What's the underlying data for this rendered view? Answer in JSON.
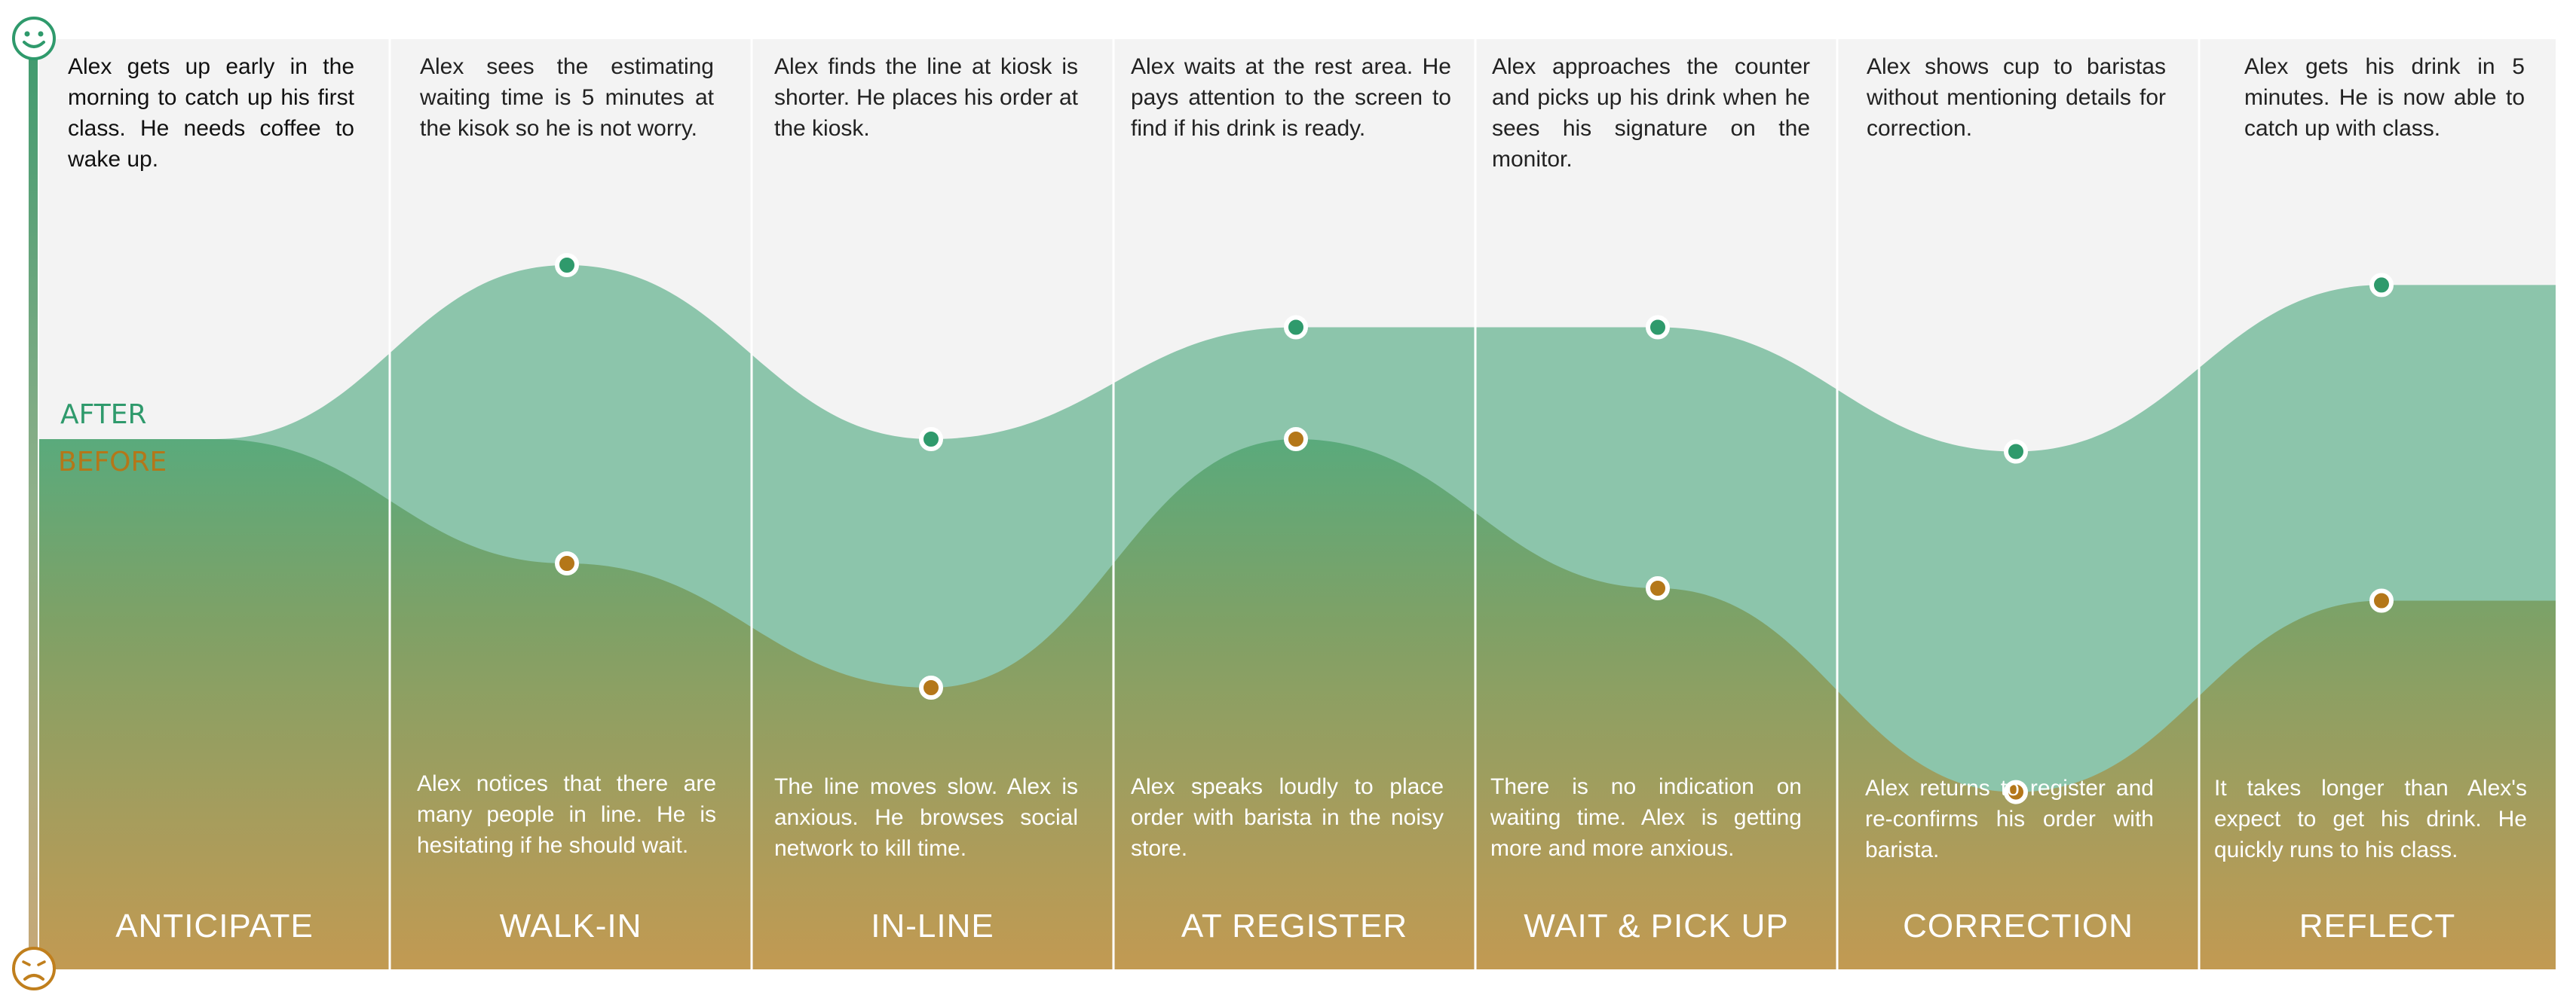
{
  "series": [
    {
      "name": "AFTER",
      "color": "#2f9a6c",
      "values": [
        0.0,
        0.7,
        0.0,
        0.45,
        0.45,
        -0.05,
        0.62
      ]
    },
    {
      "name": "BEFORE",
      "color": "#b47719",
      "values": [
        0.0,
        -0.5,
        -1.0,
        0.0,
        -0.6,
        -1.42,
        -0.65
      ]
    }
  ],
  "stages": [
    {
      "label": "ANTICIPATE",
      "top_text": "Alex gets up early in the morning to catch up his first class. He needs coffee to wake up.",
      "bottom_text": ""
    },
    {
      "label": "WALK-IN",
      "top_text": "Alex sees the estimating waiting time is 5 minutes at the kisok so he is not worry.",
      "bottom_text": "Alex notices that there are many people in line. He is hesitating if he should wait."
    },
    {
      "label": "IN-LINE",
      "top_text": "Alex finds the line at kiosk is shorter. He places his order at the kiosk.",
      "bottom_text": "The line moves slow. Alex is anxious. He browses social network to kill time."
    },
    {
      "label": "AT REGISTER",
      "top_text": "Alex waits at the rest area. He pays attention to the screen to find if his drink is ready.",
      "bottom_text": "Alex speaks loudly to place order with barista in the noisy store."
    },
    {
      "label": "WAIT & PICK UP",
      "top_text": "Alex approaches the counter and picks up his drink when he sees his signature on the monitor.",
      "bottom_text": "There is no indication on waiting time. Alex is getting more and more anxious."
    },
    {
      "label": "CORRECTION",
      "top_text": "Alex shows cup to baristas without mentioning details for correction.",
      "bottom_text": "Alex returns to register and re-confirms his order with barista."
    },
    {
      "label": "REFLECT",
      "top_text": "Alex gets his drink in 5 minutes. He is now able to catch up with class.",
      "bottom_text": "It takes longer than Alex's expect to get his drink. He quickly runs to his class."
    }
  ],
  "icons": {
    "top": "smiley-face-icon",
    "bottom": "sad-face-icon"
  },
  "colors": {
    "panel_bg": "#f3f3f3",
    "gradient_top": "#5aaa7c",
    "gradient_bottom": "#c29a52",
    "after_band": "#8cc5ab",
    "divider": "#ffffff"
  }
}
